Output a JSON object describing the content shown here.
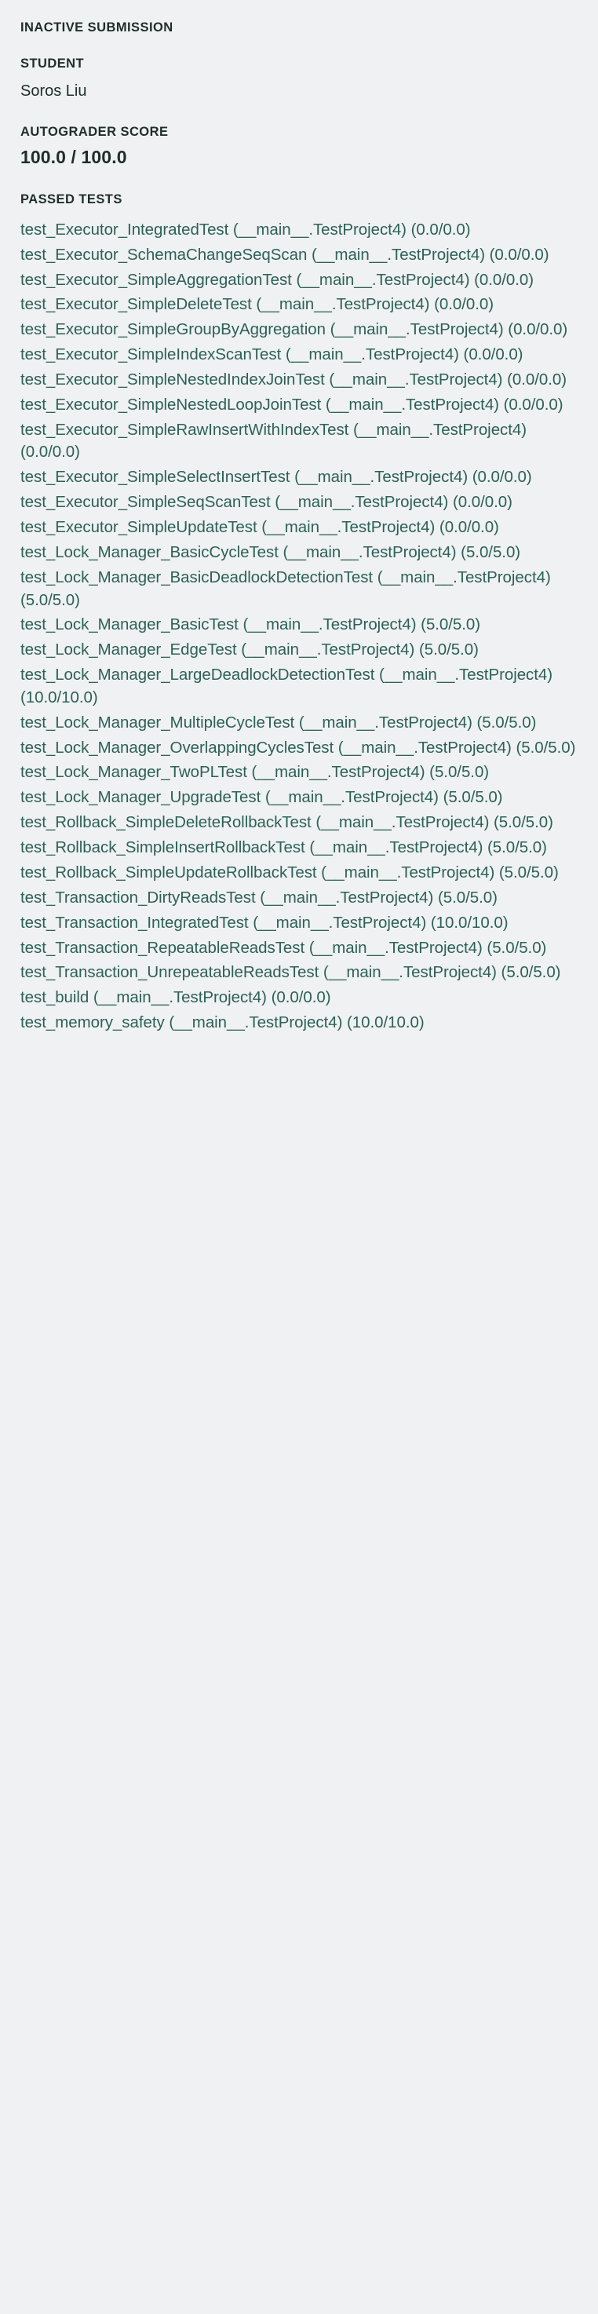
{
  "panel": {
    "submission_status_label": "INACTIVE SUBMISSION",
    "student_label": "STUDENT",
    "student_name": "Soros Liu",
    "autograder_score_label": "AUTOGRADER SCORE",
    "autograder_score_value": "100.0 / 100.0",
    "passed_tests_label": "PASSED TESTS"
  },
  "colors": {
    "background": "#eff1f2",
    "heading_text": "#1f2d2b",
    "link_text": "#2d6157"
  },
  "passed_tests": [
    {
      "name": "test_Executor_IntegratedTest",
      "suite": "(__main__.TestProject4)",
      "score": "(0.0/0.0)",
      "text": "test_Executor_IntegratedTest (__main__.TestProject4) (0.0/0.0)"
    },
    {
      "name": "test_Executor_SchemaChangeSeqScan",
      "suite": "(__main__.TestProject4)",
      "score": "(0.0/0.0)",
      "text": "test_Executor_SchemaChangeSeqScan (__main__.TestProject4) (0.0/0.0)"
    },
    {
      "name": "test_Executor_SimpleAggregationTest",
      "suite": "(__main__.TestProject4)",
      "score": "(0.0/0.0)",
      "text": "test_Executor_SimpleAggregationTest (__main__.TestProject4) (0.0/0.0)"
    },
    {
      "name": "test_Executor_SimpleDeleteTest",
      "suite": "(__main__.TestProject4)",
      "score": "(0.0/0.0)",
      "text": "test_Executor_SimpleDeleteTest (__main__.TestProject4) (0.0/0.0)"
    },
    {
      "name": "test_Executor_SimpleGroupByAggregation",
      "suite": "(__main__.TestProject4)",
      "score": "(0.0/0.0)",
      "text": "test_Executor_SimpleGroupByAggregation (__main__.TestProject4) (0.0/0.0)"
    },
    {
      "name": "test_Executor_SimpleIndexScanTest",
      "suite": "(__main__.TestProject4)",
      "score": "(0.0/0.0)",
      "text": "test_Executor_SimpleIndexScanTest (__main__.TestProject4) (0.0/0.0)"
    },
    {
      "name": "test_Executor_SimpleNestedIndexJoinTest",
      "suite": "(__main__.TestProject4)",
      "score": "(0.0/0.0)",
      "text": "test_Executor_SimpleNestedIndexJoinTest (__main__.TestProject4) (0.0/0.0)"
    },
    {
      "name": "test_Executor_SimpleNestedLoopJoinTest",
      "suite": "(__main__.TestProject4)",
      "score": "(0.0/0.0)",
      "text": "test_Executor_SimpleNestedLoopJoinTest (__main__.TestProject4) (0.0/0.0)"
    },
    {
      "name": "test_Executor_SimpleRawInsertWithIndexTest",
      "suite": "(__main__.TestProject4)",
      "score": "(0.0/0.0)",
      "text": "test_Executor_SimpleRawInsertWithIndexTest (__main__.TestProject4) (0.0/0.0)"
    },
    {
      "name": "test_Executor_SimpleSelectInsertTest",
      "suite": "(__main__.TestProject4)",
      "score": "(0.0/0.0)",
      "text": "test_Executor_SimpleSelectInsertTest (__main__.TestProject4) (0.0/0.0)"
    },
    {
      "name": "test_Executor_SimpleSeqScanTest",
      "suite": "(__main__.TestProject4)",
      "score": "(0.0/0.0)",
      "text": "test_Executor_SimpleSeqScanTest (__main__.TestProject4) (0.0/0.0)"
    },
    {
      "name": "test_Executor_SimpleUpdateTest",
      "suite": "(__main__.TestProject4)",
      "score": "(0.0/0.0)",
      "text": "test_Executor_SimpleUpdateTest (__main__.TestProject4) (0.0/0.0)"
    },
    {
      "name": "test_Lock_Manager_BasicCycleTest",
      "suite": "(__main__.TestProject4)",
      "score": "(5.0/5.0)",
      "text": "test_Lock_Manager_BasicCycleTest (__main__.TestProject4) (5.0/5.0)"
    },
    {
      "name": "test_Lock_Manager_BasicDeadlockDetectionTest",
      "suite": "(__main__.TestProject4)",
      "score": "(5.0/5.0)",
      "text": "test_Lock_Manager_BasicDeadlockDetectionTest (__main__.TestProject4) (5.0/5.0)"
    },
    {
      "name": "test_Lock_Manager_BasicTest",
      "suite": "(__main__.TestProject4)",
      "score": "(5.0/5.0)",
      "text": "test_Lock_Manager_BasicTest (__main__.TestProject4) (5.0/5.0)"
    },
    {
      "name": "test_Lock_Manager_EdgeTest",
      "suite": "(__main__.TestProject4)",
      "score": "(5.0/5.0)",
      "text": "test_Lock_Manager_EdgeTest (__main__.TestProject4) (5.0/5.0)"
    },
    {
      "name": "test_Lock_Manager_LargeDeadlockDetectionTest",
      "suite": "(__main__.TestProject4)",
      "score": "(10.0/10.0)",
      "text": "test_Lock_Manager_LargeDeadlockDetectionTest (__main__.TestProject4) (10.0/10.0)"
    },
    {
      "name": "test_Lock_Manager_MultipleCycleTest",
      "suite": "(__main__.TestProject4)",
      "score": "(5.0/5.0)",
      "text": "test_Lock_Manager_MultipleCycleTest (__main__.TestProject4) (5.0/5.0)"
    },
    {
      "name": "test_Lock_Manager_OverlappingCyclesTest",
      "suite": "(__main__.TestProject4)",
      "score": "(5.0/5.0)",
      "text": "test_Lock_Manager_OverlappingCyclesTest (__main__.TestProject4) (5.0/5.0)"
    },
    {
      "name": "test_Lock_Manager_TwoPLTest",
      "suite": "(__main__.TestProject4)",
      "score": "(5.0/5.0)",
      "text": "test_Lock_Manager_TwoPLTest (__main__.TestProject4) (5.0/5.0)"
    },
    {
      "name": "test_Lock_Manager_UpgradeTest",
      "suite": "(__main__.TestProject4)",
      "score": "(5.0/5.0)",
      "text": "test_Lock_Manager_UpgradeTest (__main__.TestProject4) (5.0/5.0)"
    },
    {
      "name": "test_Rollback_SimpleDeleteRollbackTest",
      "suite": "(__main__.TestProject4)",
      "score": "(5.0/5.0)",
      "text": "test_Rollback_SimpleDeleteRollbackTest (__main__.TestProject4) (5.0/5.0)"
    },
    {
      "name": "test_Rollback_SimpleInsertRollbackTest",
      "suite": "(__main__.TestProject4)",
      "score": "(5.0/5.0)",
      "text": "test_Rollback_SimpleInsertRollbackTest (__main__.TestProject4) (5.0/5.0)"
    },
    {
      "name": "test_Rollback_SimpleUpdateRollbackTest",
      "suite": "(__main__.TestProject4)",
      "score": "(5.0/5.0)",
      "text": "test_Rollback_SimpleUpdateRollbackTest (__main__.TestProject4) (5.0/5.0)"
    },
    {
      "name": "test_Transaction_DirtyReadsTest",
      "suite": "(__main__.TestProject4)",
      "score": "(5.0/5.0)",
      "text": "test_Transaction_DirtyReadsTest (__main__.TestProject4) (5.0/5.0)"
    },
    {
      "name": "test_Transaction_IntegratedTest",
      "suite": "(__main__.TestProject4)",
      "score": "(10.0/10.0)",
      "text": "test_Transaction_IntegratedTest (__main__.TestProject4) (10.0/10.0)"
    },
    {
      "name": "test_Transaction_RepeatableReadsTest",
      "suite": "(__main__.TestProject4)",
      "score": "(5.0/5.0)",
      "text": "test_Transaction_RepeatableReadsTest (__main__.TestProject4) (5.0/5.0)"
    },
    {
      "name": "test_Transaction_UnrepeatableReadsTest",
      "suite": "(__main__.TestProject4)",
      "score": "(5.0/5.0)",
      "text": "test_Transaction_UnrepeatableReadsTest (__main__.TestProject4) (5.0/5.0)"
    },
    {
      "name": "test_build",
      "suite": "(__main__.TestProject4)",
      "score": "(0.0/0.0)",
      "text": "test_build (__main__.TestProject4) (0.0/0.0)"
    },
    {
      "name": "test_memory_safety",
      "suite": "(__main__.TestProject4)",
      "score": "(10.0/10.0)",
      "text": "test_memory_safety (__main__.TestProject4) (10.0/10.0)"
    }
  ]
}
